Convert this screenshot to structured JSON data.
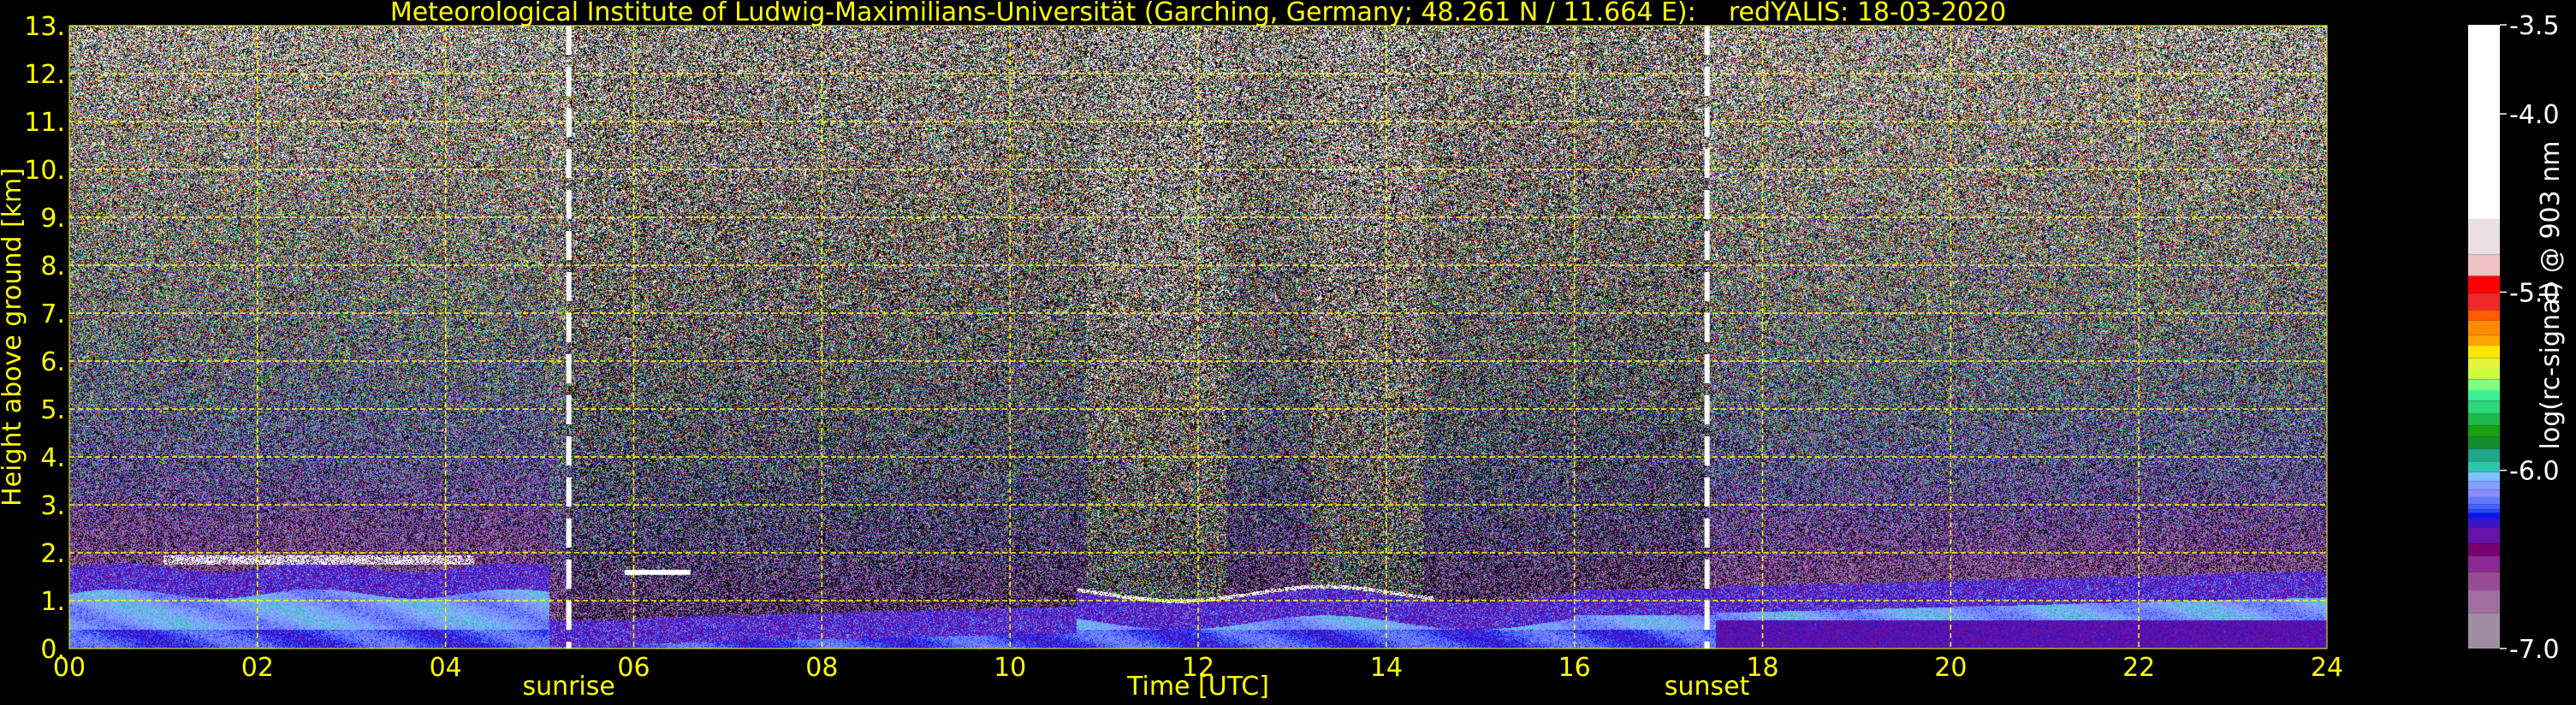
{
  "chart_data": {
    "type": "heatmap",
    "title": "Meteorological Institute of Ludwig-Maximilians-Universität (Garching, Germany; 48.261 N / 11.664 E):    redYALIS: 18-03-2020",
    "xlabel": "Time [UTC]",
    "ylabel": "Height above ground [km]",
    "xlim": [
      0,
      24
    ],
    "ylim": [
      0,
      13
    ],
    "xticks": [
      "00",
      "02",
      "04",
      "06",
      "08",
      "10",
      "12",
      "14",
      "16",
      "18",
      "20",
      "22",
      "24"
    ],
    "yticks": [
      "0.",
      "1.",
      "2.",
      "3.",
      "4.",
      "5.",
      "6.",
      "7.",
      "8.",
      "9.",
      "10.",
      "11.",
      "12.",
      "13."
    ],
    "grid": true,
    "grid_color": "#ffff00",
    "text_color": "#ffff00",
    "annotations": [
      {
        "label": "sunrise",
        "time_utc": 5.31
      },
      {
        "label": "sunset",
        "time_utc": 17.41
      }
    ],
    "colorbar": {
      "label": "log(rc-signal) @ 903 nm",
      "range": [
        -7.0,
        -3.5
      ],
      "ticks": [
        "-3.5",
        "-4.0",
        "-5.0",
        "-6.0",
        "-7.0"
      ],
      "tick_values": [
        -3.5,
        -4.0,
        -5.0,
        -6.0,
        -7.0
      ],
      "bands": [
        {
          "from": -3.5,
          "to": -4.59,
          "color": "#ffffff"
        },
        {
          "from": -4.59,
          "to": -4.79,
          "color": "#ebe0e3"
        },
        {
          "from": -4.79,
          "to": -4.91,
          "color": "#f0c4c6"
        },
        {
          "from": -4.91,
          "to": -5.005,
          "color": "#ff0000"
        },
        {
          "from": -5.005,
          "to": -5.1,
          "color": "#f02828"
        },
        {
          "from": -5.1,
          "to": -5.16,
          "color": "#ff5a00"
        },
        {
          "from": -5.16,
          "to": -5.24,
          "color": "#ff8c00"
        },
        {
          "from": -5.24,
          "to": -5.3,
          "color": "#ffa500"
        },
        {
          "from": -5.3,
          "to": -5.37,
          "color": "#ffe600"
        },
        {
          "from": -5.37,
          "to": -5.43,
          "color": "#e6f53c"
        },
        {
          "from": -5.43,
          "to": -5.49,
          "color": "#c8ff3c"
        },
        {
          "from": -5.49,
          "to": -5.55,
          "color": "#80ff80"
        },
        {
          "from": -5.55,
          "to": -5.61,
          "color": "#3cf096"
        },
        {
          "from": -5.61,
          "to": -5.68,
          "color": "#2ed67c"
        },
        {
          "from": -5.68,
          "to": -5.75,
          "color": "#1eb84a"
        },
        {
          "from": -5.75,
          "to": -5.81,
          "color": "#1aa010"
        },
        {
          "from": -5.81,
          "to": -5.88,
          "color": "#148c2d"
        },
        {
          "from": -5.88,
          "to": -5.95,
          "color": "#1ea58c"
        },
        {
          "from": -5.95,
          "to": -6.01,
          "color": "#2ec8a8"
        },
        {
          "from": -6.01,
          "to": -6.06,
          "color": "#7fc0ff"
        },
        {
          "from": -6.06,
          "to": -6.11,
          "color": "#82a0ff"
        },
        {
          "from": -6.11,
          "to": -6.15,
          "color": "#8c8cff"
        },
        {
          "from": -6.15,
          "to": -6.19,
          "color": "#6478ff"
        },
        {
          "from": -6.19,
          "to": -6.22,
          "color": "#4664ff"
        },
        {
          "from": -6.22,
          "to": -6.24,
          "color": "#2846ff"
        },
        {
          "from": -6.24,
          "to": -6.27,
          "color": "#0a14f0"
        },
        {
          "from": -6.27,
          "to": -6.32,
          "color": "#3c14c8"
        },
        {
          "from": -6.32,
          "to": -6.41,
          "color": "#6414aa"
        },
        {
          "from": -6.41,
          "to": -6.48,
          "color": "#78006e"
        },
        {
          "from": -6.48,
          "to": -6.57,
          "color": "#8c2896"
        },
        {
          "from": -6.57,
          "to": -6.67,
          "color": "#964b96"
        },
        {
          "from": -6.67,
          "to": -6.8,
          "color": "#a06ea0"
        },
        {
          "from": -6.8,
          "to": -7.0,
          "color": "#a08ca0"
        }
      ]
    }
  }
}
